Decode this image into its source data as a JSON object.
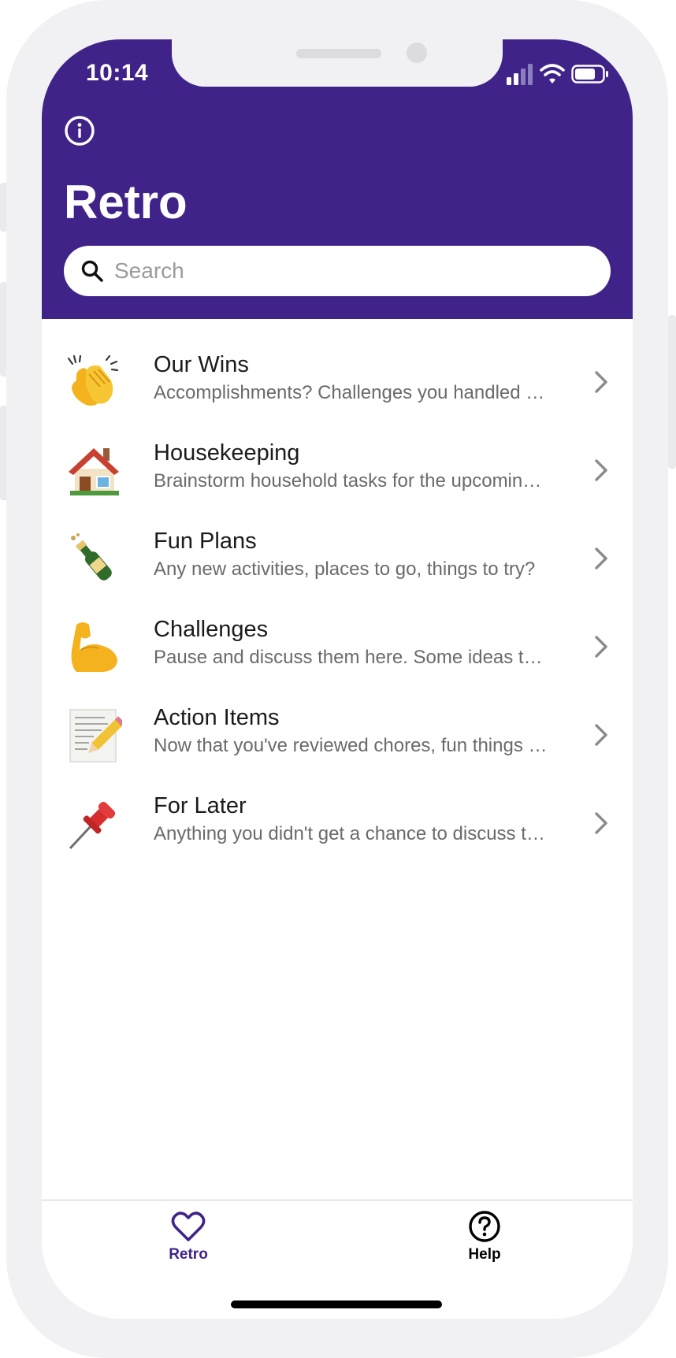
{
  "colors": {
    "brand": "#3f2389",
    "header_text": "#ffffff",
    "subtitle": "#6a6a6a",
    "chevron": "#8a8a8e",
    "active_tab": "#3f2389",
    "inactive_tab": "#000000"
  },
  "status_bar": {
    "time": "10:14",
    "icons": [
      "cellular-signal-icon",
      "wifi-icon",
      "battery-icon"
    ]
  },
  "header": {
    "info_icon": "info-circle-icon",
    "title": "Retro",
    "search": {
      "placeholder": "Search",
      "value": ""
    }
  },
  "list": {
    "items": [
      {
        "icon": "clapping-hands-emoji",
        "title": "Our Wins",
        "subtitle": "Accomplishments? Challenges you handled well? Celebrate them here."
      },
      {
        "icon": "house-emoji",
        "title": "Housekeeping",
        "subtitle": "Brainstorm household tasks for the upcoming week."
      },
      {
        "icon": "champagne-bottle-emoji",
        "title": "Fun Plans",
        "subtitle": "Any new activities, places to go, things to try?"
      },
      {
        "icon": "flexed-biceps-emoji",
        "title": "Challenges",
        "subtitle": "Pause and discuss them here. Some ideas to consider."
      },
      {
        "icon": "memo-pencil-emoji",
        "title": "Action Items",
        "subtitle": "Now that you've reviewed chores, fun things and challenges."
      },
      {
        "icon": "pushpin-emoji",
        "title": "For Later",
        "subtitle": "Anything you didn't get a chance to discuss this week."
      }
    ],
    "chevron_icon": "chevron-right-icon"
  },
  "tab_bar": {
    "tabs": [
      {
        "label": "Retro",
        "icon": "heart-icon",
        "active": true
      },
      {
        "label": "Help",
        "icon": "help-circle-icon",
        "active": false
      }
    ]
  }
}
